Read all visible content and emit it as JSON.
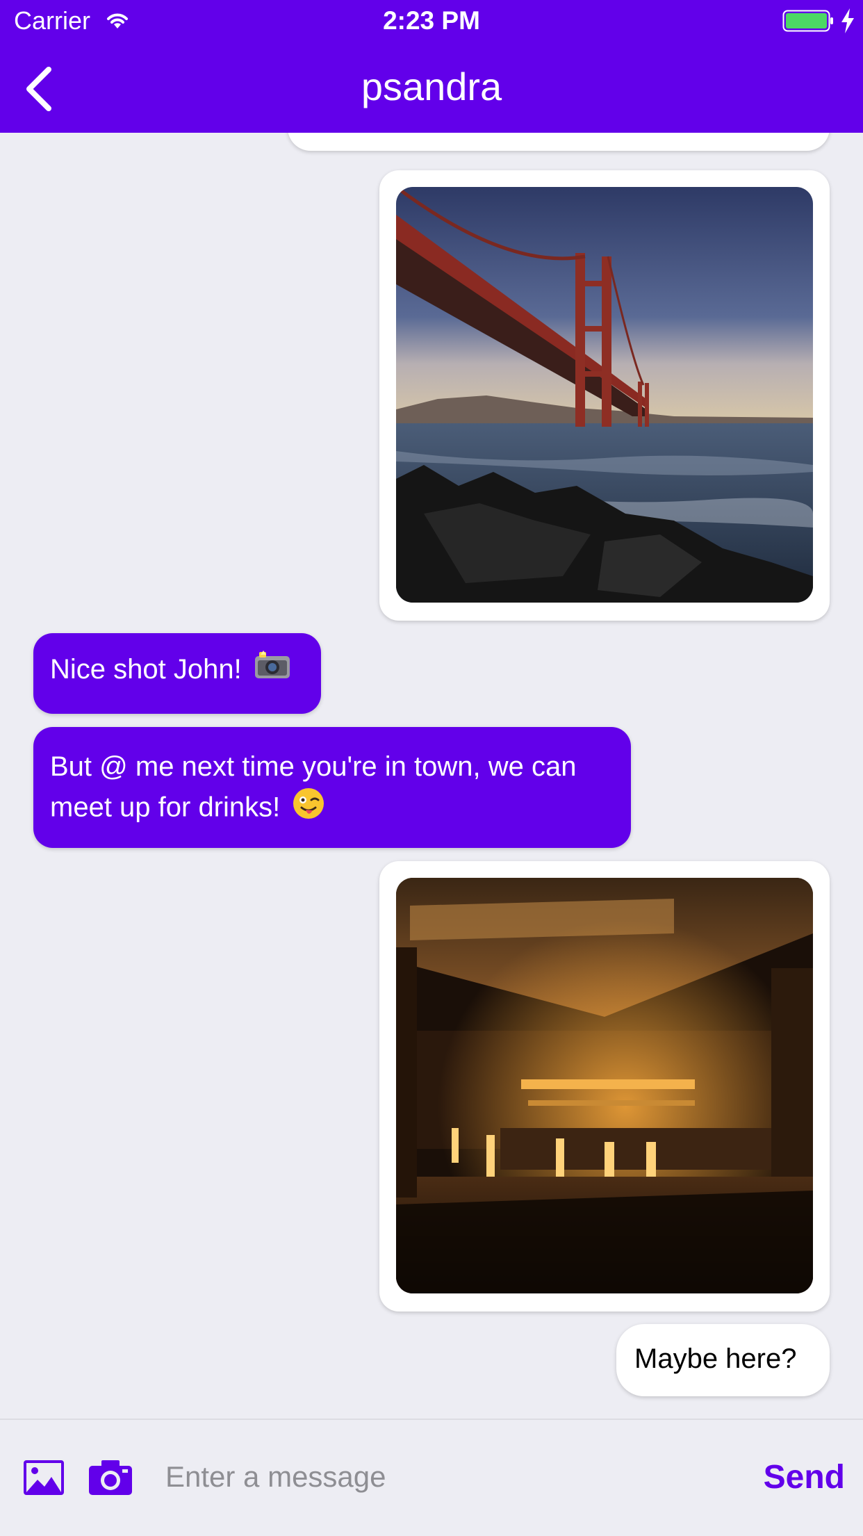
{
  "status_bar": {
    "carrier": "Carrier",
    "time": "2:23 PM"
  },
  "header": {
    "title": "psandra"
  },
  "messages": [
    {
      "type": "image",
      "side": "right",
      "image_icon": "golden-gate-bridge-photo"
    },
    {
      "type": "text",
      "side": "left",
      "text": "Nice shot John!",
      "emoji": "camera-emoji"
    },
    {
      "type": "text",
      "side": "left",
      "line1": "But @ me next time you're in town, we can",
      "line2": "meet up for drinks!",
      "emoji": "winking-tongue-emoji"
    },
    {
      "type": "image",
      "side": "right",
      "image_icon": "bar-interior-photo"
    },
    {
      "type": "text",
      "side": "right",
      "text": "Maybe here?"
    }
  ],
  "input_bar": {
    "placeholder": "Enter a message",
    "send_label": "Send"
  },
  "colors": {
    "accent": "#6200EA",
    "background": "#EDEDF3",
    "bubble_white": "#FFFFFF"
  }
}
